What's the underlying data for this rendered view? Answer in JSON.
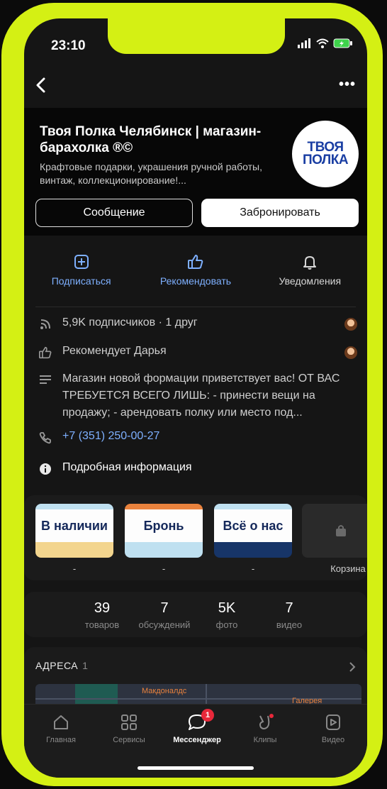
{
  "status_bar": {
    "time": "23:10"
  },
  "profile": {
    "title": "Твоя Полка Челябинск | магазин-барахолка ®©",
    "subtitle": "Крафтовые подарки, украшения ручной работы, винтаж, коллекционирование!...",
    "logo_line1": "ТВОЯ",
    "logo_line2": "ПОЛКА",
    "message_button": "Сообщение",
    "book_button": "Забронировать"
  },
  "actions": [
    {
      "label": "Подписаться",
      "icon": "plus-square-icon"
    },
    {
      "label": "Рекомендовать",
      "icon": "thumbs-up-icon"
    },
    {
      "label": "Уведомления",
      "icon": "bell-icon"
    }
  ],
  "info": {
    "subscribers": "5,9K подписчиков · 1 друг",
    "recommends": "Рекомендует Дарья",
    "description": "Магазин новой формации приветствует вас! ОТ ВАС ТРЕБУЕТСЯ ВСЕГО ЛИШЬ: - принести вещи на продажу; - арендовать полку или место под...",
    "phone": "+7 (351) 250-00-27",
    "details": "Подробная информация"
  },
  "tiles": [
    {
      "label": "В наличии",
      "caption": "-",
      "top_color": "#bfe0f0",
      "bottom_color": "#f3d58e"
    },
    {
      "label": "Бронь",
      "caption": "-",
      "top_color": "#e9823d",
      "bottom_color": "#bfe0f0"
    },
    {
      "label": "Всё о нас",
      "caption": "-",
      "top_color": "#bfe0f0",
      "bottom_color": "#173568"
    },
    {
      "label": "",
      "caption": "Корзина"
    }
  ],
  "stats": [
    {
      "value": "39",
      "label": "товаров"
    },
    {
      "value": "7",
      "label": "обсуждений"
    },
    {
      "value": "5K",
      "label": "фото"
    },
    {
      "value": "7",
      "label": "видео"
    }
  ],
  "addresses": {
    "title": "АДРЕСА",
    "count": "1",
    "map_label1": "Макдоналдс",
    "map_label2": "Галерея"
  },
  "tabbar": [
    {
      "label": "Главная",
      "icon": "home-icon"
    },
    {
      "label": "Сервисы",
      "icon": "services-grid-icon"
    },
    {
      "label": "Мессенджер",
      "icon": "messenger-icon",
      "badge": "1"
    },
    {
      "label": "Клипы",
      "icon": "clips-icon"
    },
    {
      "label": "Видео",
      "icon": "video-icon"
    }
  ],
  "colors": {
    "accent_blue": "#7eb0ff",
    "frame": "#d4f014",
    "badge": "#e8283a"
  }
}
